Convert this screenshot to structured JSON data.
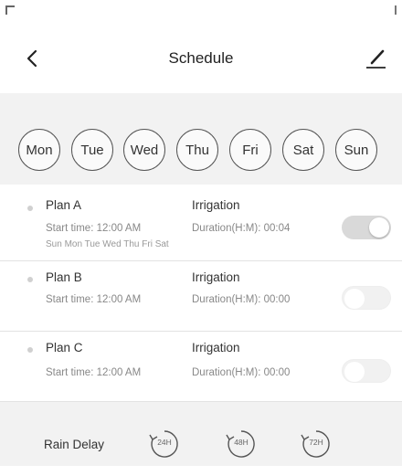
{
  "header": {
    "title": "Schedule",
    "back_icon": "chevron-left-icon",
    "edit_icon": "pencil-icon"
  },
  "days": [
    "Mon",
    "Tue",
    "Wed",
    "Thu",
    "Fri",
    "Sat",
    "Sun"
  ],
  "plans": [
    {
      "name": "Plan A",
      "type": "Irrigation",
      "start_time": "Start time: 12:00 AM",
      "duration": "Duration(H:M): 00:04",
      "days": "Sun Mon Tue Wed Thu Fri Sat",
      "enabled": true
    },
    {
      "name": "Plan B",
      "type": "Irrigation",
      "start_time": "Start time: 12:00 AM",
      "duration": "Duration(H:M): 00:00",
      "enabled": false
    },
    {
      "name": "Plan C",
      "type": "Irrigation",
      "start_time": "Start time: 12:00 AM",
      "duration": "Duration(H:M): 00:00",
      "enabled": false
    }
  ],
  "rain_delay": {
    "label": "Rain Delay",
    "options": [
      "24H",
      "48H",
      "72H"
    ]
  },
  "colors": {
    "background": "#ffffff",
    "panel": "#f2f2f2",
    "toggle_on": "#d9d9d9"
  }
}
